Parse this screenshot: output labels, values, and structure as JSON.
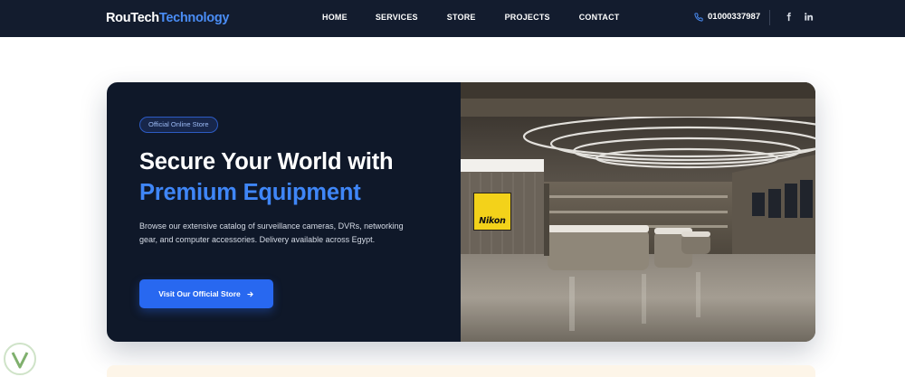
{
  "brand": {
    "name_part1": "RouTech",
    "name_part2": "Technology"
  },
  "nav": {
    "items": [
      {
        "label": "HOME"
      },
      {
        "label": "SERVICES"
      },
      {
        "label": "STORE"
      },
      {
        "label": "PROJECTS"
      },
      {
        "label": "CONTACT"
      }
    ],
    "phone": "01000337987",
    "social": [
      "facebook-icon",
      "linkedin-icon"
    ]
  },
  "hero": {
    "badge": "Official Online Store",
    "headline_line1": "Secure Your World with",
    "headline_line2": "Premium Equipment",
    "description": "Browse our extensive catalog of surveillance cameras, DVRs, networking gear, and computer accessories. Delivery available across Egypt.",
    "cta_label": "Visit Our Official Store",
    "store_sign": "Nikon"
  },
  "colors": {
    "navbar_bg": "#131c2e",
    "hero_bg": "#0f1829",
    "accent_blue": "#3f86f7",
    "button_blue": "#2868f0"
  }
}
